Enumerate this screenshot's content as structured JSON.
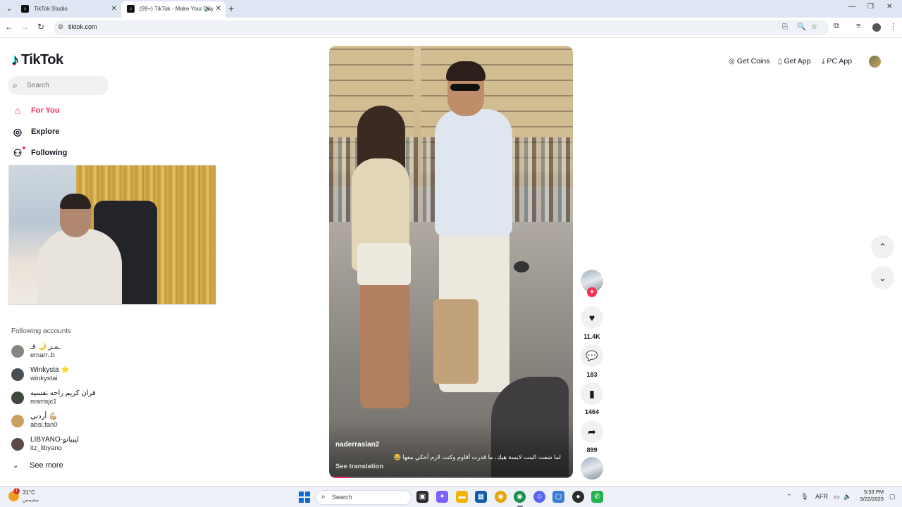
{
  "browser": {
    "tabs": [
      {
        "title": "TikTok Studio",
        "active": false
      },
      {
        "title": "(99+) TikTok - Make Your Day",
        "active": true
      }
    ],
    "url": "tiktok.com"
  },
  "tiktok": {
    "logo_text": "TikTok",
    "search_placeholder": "Search",
    "nav": [
      {
        "label": "For You",
        "icon": "home-icon",
        "active": true
      },
      {
        "label": "Explore",
        "icon": "compass-icon",
        "active": false
      },
      {
        "label": "Following",
        "icon": "following-icon",
        "active": false
      }
    ],
    "following_title": "Following accounts",
    "accounts": [
      {
        "name": "قـ 🌙 ـمـر",
        "username": "emarr..b",
        "avatar_color": "#8a8580"
      },
      {
        "name": "Winkysta ⭐",
        "username": "winkystai",
        "avatar_color": "#4a4f55"
      },
      {
        "name": "قران كريم راحه نفسيه",
        "username": "msmsjc1",
        "avatar_color": "#3f4a3c"
      },
      {
        "name": "أردني 💪🏼",
        "username": "absi.fan0",
        "avatar_color": "#c8a060"
      },
      {
        "name": "LIBYANO-ليبيانو",
        "username": "itz_libyano",
        "avatar_color": "#5a4a48"
      }
    ],
    "see_more": "See more",
    "header_links": {
      "get_coins": "Get Coins",
      "get_app": "Get App",
      "pc_app": "PC App"
    },
    "video": {
      "author": "naderraslan2",
      "caption": "لما شفت البنت لابسة هيك، ما قدرت أقاوم وكنت لازم أحكي معها 😂",
      "see_translation": "See translation",
      "progress": 0.08
    },
    "actions": {
      "likes": "11.4K",
      "comments": "183",
      "saves": "1464",
      "shares": "899"
    }
  },
  "taskbar": {
    "weather_temp": "31°C",
    "weather_sub": "مشمس",
    "weather_badge": "1",
    "search": "Search",
    "lang": "AFR",
    "time": "5:53 PM",
    "date": "9/22/2025"
  }
}
